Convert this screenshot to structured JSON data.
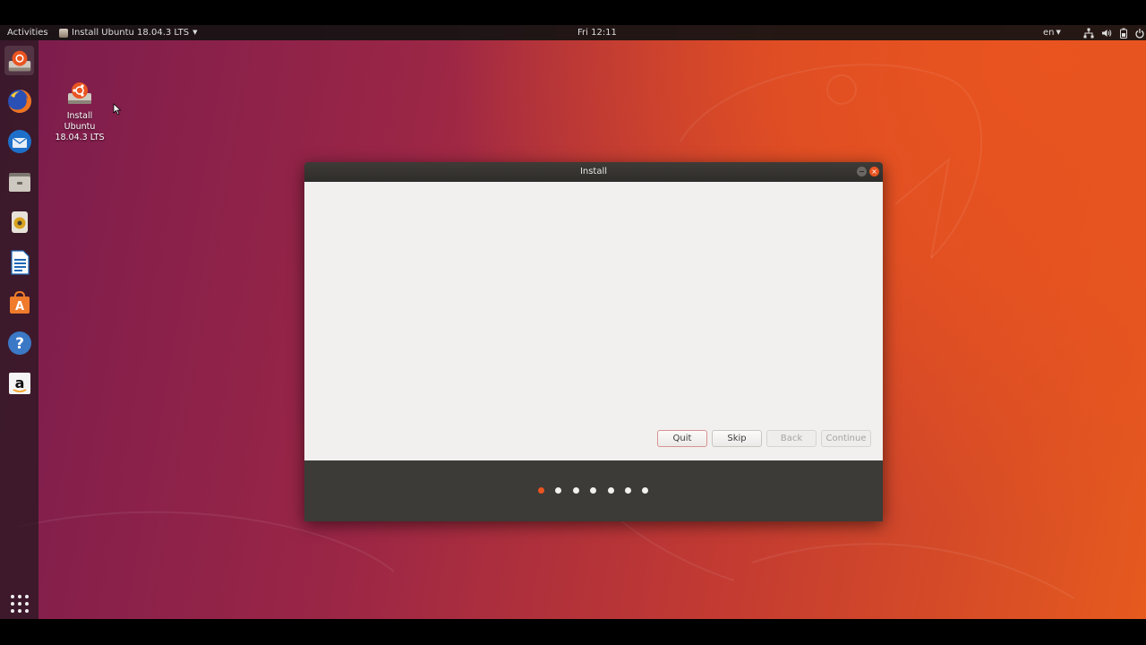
{
  "top_panel": {
    "activities": "Activities",
    "app_name": "Install Ubuntu 18.04.3 LTS",
    "clock": "Fri 12:11",
    "language": "en",
    "system_icons": [
      "network-icon",
      "volume-icon",
      "battery-icon",
      "power-icon"
    ]
  },
  "dock": {
    "items": [
      {
        "icon": "ubuntu-installer-icon",
        "active": true
      },
      {
        "icon": "firefox-icon"
      },
      {
        "icon": "thunderbird-icon"
      },
      {
        "icon": "files-icon"
      },
      {
        "icon": "rhythmbox-icon"
      },
      {
        "icon": "libreoffice-writer-icon"
      },
      {
        "icon": "ubuntu-software-icon"
      },
      {
        "icon": "help-icon"
      },
      {
        "icon": "amazon-icon"
      }
    ],
    "show_applications_icon": "grid-icon"
  },
  "desktop": {
    "icon_label_lines": [
      "Install",
      "Ubuntu",
      "18.04.3 LTS"
    ]
  },
  "window": {
    "title": "Install",
    "buttons": {
      "quit": "Quit",
      "skip": "Skip",
      "back": "Back",
      "continue": "Continue"
    },
    "steps_total": 7,
    "current_step": 1,
    "accent_color": "#e95420"
  }
}
